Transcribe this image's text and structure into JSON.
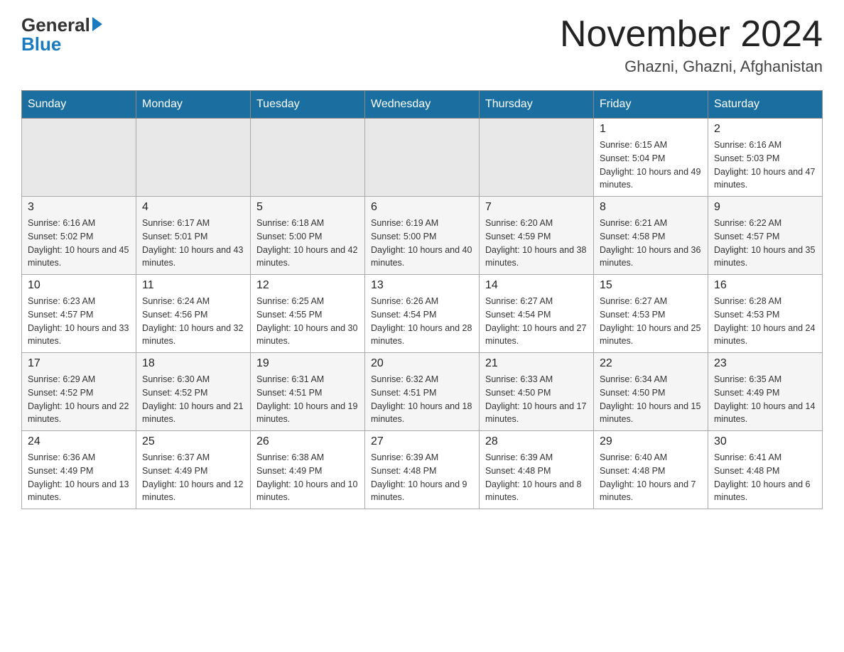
{
  "header": {
    "logo_general": "General",
    "logo_blue": "Blue",
    "month_title": "November 2024",
    "location": "Ghazni, Ghazni, Afghanistan"
  },
  "days_of_week": [
    "Sunday",
    "Monday",
    "Tuesday",
    "Wednesday",
    "Thursday",
    "Friday",
    "Saturday"
  ],
  "weeks": [
    {
      "row": 1,
      "cells": [
        {
          "day": "",
          "info": ""
        },
        {
          "day": "",
          "info": ""
        },
        {
          "day": "",
          "info": ""
        },
        {
          "day": "",
          "info": ""
        },
        {
          "day": "",
          "info": ""
        },
        {
          "day": "1",
          "info": "Sunrise: 6:15 AM\nSunset: 5:04 PM\nDaylight: 10 hours and 49 minutes."
        },
        {
          "day": "2",
          "info": "Sunrise: 6:16 AM\nSunset: 5:03 PM\nDaylight: 10 hours and 47 minutes."
        }
      ]
    },
    {
      "row": 2,
      "cells": [
        {
          "day": "3",
          "info": "Sunrise: 6:16 AM\nSunset: 5:02 PM\nDaylight: 10 hours and 45 minutes."
        },
        {
          "day": "4",
          "info": "Sunrise: 6:17 AM\nSunset: 5:01 PM\nDaylight: 10 hours and 43 minutes."
        },
        {
          "day": "5",
          "info": "Sunrise: 6:18 AM\nSunset: 5:00 PM\nDaylight: 10 hours and 42 minutes."
        },
        {
          "day": "6",
          "info": "Sunrise: 6:19 AM\nSunset: 5:00 PM\nDaylight: 10 hours and 40 minutes."
        },
        {
          "day": "7",
          "info": "Sunrise: 6:20 AM\nSunset: 4:59 PM\nDaylight: 10 hours and 38 minutes."
        },
        {
          "day": "8",
          "info": "Sunrise: 6:21 AM\nSunset: 4:58 PM\nDaylight: 10 hours and 36 minutes."
        },
        {
          "day": "9",
          "info": "Sunrise: 6:22 AM\nSunset: 4:57 PM\nDaylight: 10 hours and 35 minutes."
        }
      ]
    },
    {
      "row": 3,
      "cells": [
        {
          "day": "10",
          "info": "Sunrise: 6:23 AM\nSunset: 4:57 PM\nDaylight: 10 hours and 33 minutes."
        },
        {
          "day": "11",
          "info": "Sunrise: 6:24 AM\nSunset: 4:56 PM\nDaylight: 10 hours and 32 minutes."
        },
        {
          "day": "12",
          "info": "Sunrise: 6:25 AM\nSunset: 4:55 PM\nDaylight: 10 hours and 30 minutes."
        },
        {
          "day": "13",
          "info": "Sunrise: 6:26 AM\nSunset: 4:54 PM\nDaylight: 10 hours and 28 minutes."
        },
        {
          "day": "14",
          "info": "Sunrise: 6:27 AM\nSunset: 4:54 PM\nDaylight: 10 hours and 27 minutes."
        },
        {
          "day": "15",
          "info": "Sunrise: 6:27 AM\nSunset: 4:53 PM\nDaylight: 10 hours and 25 minutes."
        },
        {
          "day": "16",
          "info": "Sunrise: 6:28 AM\nSunset: 4:53 PM\nDaylight: 10 hours and 24 minutes."
        }
      ]
    },
    {
      "row": 4,
      "cells": [
        {
          "day": "17",
          "info": "Sunrise: 6:29 AM\nSunset: 4:52 PM\nDaylight: 10 hours and 22 minutes."
        },
        {
          "day": "18",
          "info": "Sunrise: 6:30 AM\nSunset: 4:52 PM\nDaylight: 10 hours and 21 minutes."
        },
        {
          "day": "19",
          "info": "Sunrise: 6:31 AM\nSunset: 4:51 PM\nDaylight: 10 hours and 19 minutes."
        },
        {
          "day": "20",
          "info": "Sunrise: 6:32 AM\nSunset: 4:51 PM\nDaylight: 10 hours and 18 minutes."
        },
        {
          "day": "21",
          "info": "Sunrise: 6:33 AM\nSunset: 4:50 PM\nDaylight: 10 hours and 17 minutes."
        },
        {
          "day": "22",
          "info": "Sunrise: 6:34 AM\nSunset: 4:50 PM\nDaylight: 10 hours and 15 minutes."
        },
        {
          "day": "23",
          "info": "Sunrise: 6:35 AM\nSunset: 4:49 PM\nDaylight: 10 hours and 14 minutes."
        }
      ]
    },
    {
      "row": 5,
      "cells": [
        {
          "day": "24",
          "info": "Sunrise: 6:36 AM\nSunset: 4:49 PM\nDaylight: 10 hours and 13 minutes."
        },
        {
          "day": "25",
          "info": "Sunrise: 6:37 AM\nSunset: 4:49 PM\nDaylight: 10 hours and 12 minutes."
        },
        {
          "day": "26",
          "info": "Sunrise: 6:38 AM\nSunset: 4:49 PM\nDaylight: 10 hours and 10 minutes."
        },
        {
          "day": "27",
          "info": "Sunrise: 6:39 AM\nSunset: 4:48 PM\nDaylight: 10 hours and 9 minutes."
        },
        {
          "day": "28",
          "info": "Sunrise: 6:39 AM\nSunset: 4:48 PM\nDaylight: 10 hours and 8 minutes."
        },
        {
          "day": "29",
          "info": "Sunrise: 6:40 AM\nSunset: 4:48 PM\nDaylight: 10 hours and 7 minutes."
        },
        {
          "day": "30",
          "info": "Sunrise: 6:41 AM\nSunset: 4:48 PM\nDaylight: 10 hours and 6 minutes."
        }
      ]
    }
  ]
}
